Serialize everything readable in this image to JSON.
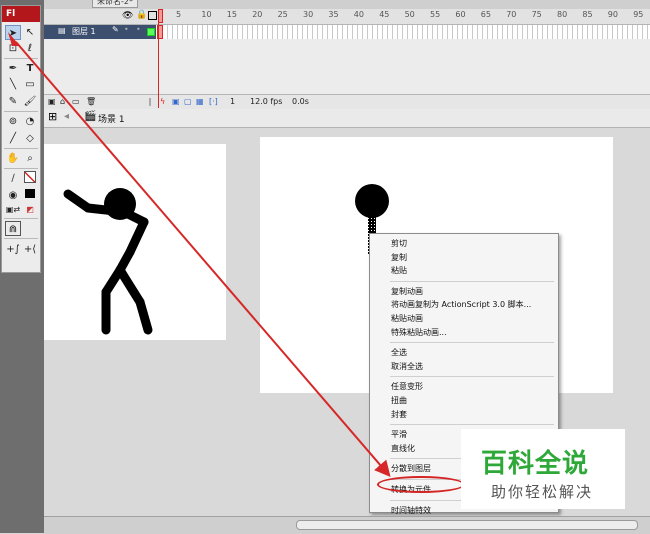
{
  "app": {
    "logo": "Fl",
    "document_tab": "未命名-2*"
  },
  "timeline": {
    "frame_numbers": [
      "5",
      "10",
      "15",
      "20",
      "25",
      "30",
      "35",
      "40",
      "45",
      "50",
      "55",
      "60",
      "65",
      "70",
      "75",
      "80",
      "85",
      "90",
      "95"
    ],
    "layer_name": "图层 1",
    "footer": {
      "current_frame": "1",
      "fps": "12.0 fps",
      "time": "0.0s"
    }
  },
  "edit_bar": {
    "scene": "场景 1"
  },
  "context_menu": {
    "groups": [
      [
        "剪切",
        "复制",
        "粘贴"
      ],
      [
        "复制动画",
        "将动画复制为 ActionScript 3.0 脚本...",
        "粘贴动画",
        "特殊粘贴动画..."
      ],
      [
        "全选",
        "取消全选"
      ],
      [
        "任意变形",
        "扭曲",
        "封套"
      ],
      [
        "平滑",
        "直线化"
      ],
      [
        "分散到图层"
      ],
      [
        "转换为元件..."
      ],
      [
        "时间轴特效"
      ]
    ]
  },
  "watermark": {
    "title": "百科全说",
    "subtitle": "助你轻松解决"
  },
  "colors": {
    "annotation_red": "#d62828",
    "brand_red": "#b3161b",
    "watermark_green": "#2fa83a",
    "layer_highlight": "#3c4f6e"
  },
  "icons": {
    "tools": [
      "selection-arrow-icon",
      "subselection-icon",
      "free-transform-icon",
      "lasso-icon",
      "pen-icon",
      "text-icon",
      "line-icon",
      "rectangle-icon",
      "pencil-icon",
      "brush-icon",
      "ink-bottle-icon",
      "paint-bucket-icon",
      "eyedropper-icon",
      "eraser-icon",
      "hand-icon",
      "zoom-icon",
      "stroke-color-icon",
      "fill-color-icon",
      "swap-colors-icon",
      "snap-magnet-icon",
      "smooth-icon",
      "straighten-icon"
    ]
  }
}
